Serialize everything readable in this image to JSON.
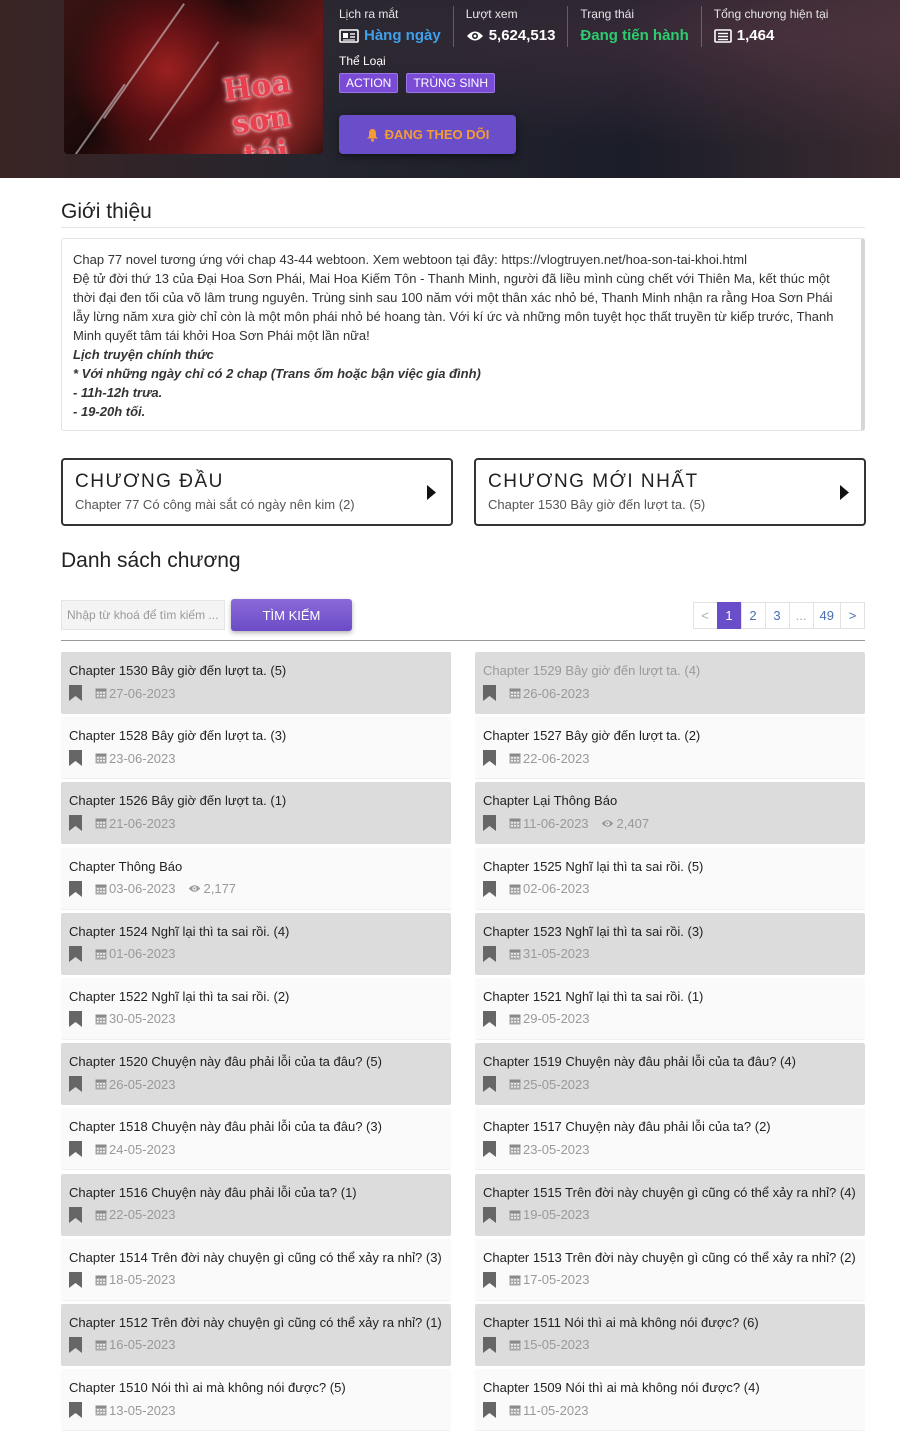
{
  "header": {
    "cover_title": "Hoa sơn tái khởi",
    "stats": [
      {
        "label": "Lịch ra mắt",
        "value": "Hàng ngày",
        "icon": "newspaper-icon",
        "color": "#3fa0ea"
      },
      {
        "label": "Lượt xem",
        "value": "5,624,513",
        "icon": "eye-icon",
        "color": "#ffffff"
      },
      {
        "label": "Trạng thái",
        "value": "Đang tiến hành",
        "icon": "",
        "color": "#2ecc71"
      },
      {
        "label": "Tổng chương hiện tại",
        "value": "1,464",
        "icon": "list-icon",
        "color": "#ffffff"
      }
    ],
    "genre_label": "Thể Loại",
    "genres": [
      "ACTION",
      "TRÙNG SINH"
    ],
    "follow_label": "ĐANG THEO DÕI"
  },
  "intro": {
    "title": "Giới thiệu",
    "lines": [
      "Chap 77 novel tương ứng với chap 43-44 webtoon. Xem webtoon tại đây: https://vlogtruyen.net/hoa-son-tai-khoi.html",
      "Đệ tử đời thứ 13 của Đại Hoa Sơn Phái, Mai Hoa Kiếm Tôn - Thanh Minh, người đã liều mình cùng chết với Thiên Ma, kết thúc một thời đại đen tối của võ lâm trung nguyên. Trùng sinh sau 100 năm với một thân xác nhỏ bé, Thanh Minh nhận ra rằng Hoa Sơn Phái lẫy lừng năm xưa giờ chỉ còn là một môn phái nhỏ bé hoang tàn. Với kí ức và những môn tuyệt học thất truyền từ kiếp trước, Thanh Minh quyết tâm tái khởi Hoa Sơn Phái một lần nữa!"
    ],
    "schedule_lines": [
      "Lịch truyện chính thức",
      "* Với những ngày chỉ có 2 chap (Trans ốm hoặc bận việc gia đình)",
      "- 11h-12h trưa.",
      "- 19-20h tối."
    ]
  },
  "jump": {
    "first": {
      "title": "CHƯƠNG ĐẦU",
      "chapter": "Chapter 77 Có công mài sắt có ngày nên kim (2)"
    },
    "latest": {
      "title": "CHƯƠNG MỚI NHẤT",
      "chapter": "Chapter 1530 Bây giờ đến lượt ta. (5)"
    }
  },
  "chapters_section": {
    "title": "Danh sách chương",
    "search_placeholder": "Nhập từ khoá để tìm kiếm ...",
    "search_button": "TÌM KIẾM",
    "pagination": [
      "<",
      "1",
      "2",
      "3",
      "...",
      "49",
      ">"
    ],
    "active_page": "1"
  },
  "chapters": [
    [
      {
        "name": "Chapter 1530 Bây giờ đến lượt ta. (5)",
        "date": "27-06-2023",
        "shaded": true
      },
      {
        "name": "Chapter 1529 Bây giờ đến lượt ta. (4)",
        "date": "26-06-2023",
        "shaded": true,
        "read": true
      }
    ],
    [
      {
        "name": "Chapter 1528 Bây giờ đến lượt ta. (3)",
        "date": "23-06-2023"
      },
      {
        "name": "Chapter 1527 Bây giờ đến lượt ta. (2)",
        "date": "22-06-2023"
      }
    ],
    [
      {
        "name": "Chapter 1526 Bây giờ đến lượt ta. (1)",
        "date": "21-06-2023",
        "shaded": true
      },
      {
        "name": "Chapter Lại Thông Báo",
        "date": "11-06-2023",
        "views": "2,407",
        "shaded": true
      }
    ],
    [
      {
        "name": "Chapter Thông Báo",
        "date": "03-06-2023",
        "views": "2,177"
      },
      {
        "name": "Chapter 1525 Nghĩ lại thì ta sai rồi. (5)",
        "date": "02-06-2023"
      }
    ],
    [
      {
        "name": "Chapter 1524 Nghĩ lại thì ta sai rồi. (4)",
        "date": "01-06-2023",
        "shaded": true
      },
      {
        "name": "Chapter 1523 Nghĩ lại thì ta sai rồi. (3)",
        "date": "31-05-2023",
        "shaded": true
      }
    ],
    [
      {
        "name": "Chapter 1522 Nghĩ lại thì ta sai rồi. (2)",
        "date": "30-05-2023"
      },
      {
        "name": "Chapter 1521 Nghĩ lại thì ta sai rồi. (1)",
        "date": "29-05-2023"
      }
    ],
    [
      {
        "name": "Chapter 1520 Chuyện này đâu phải lỗi của ta đâu? (5)",
        "date": "26-05-2023",
        "shaded": true
      },
      {
        "name": "Chapter 1519 Chuyện này đâu phải lỗi của ta đâu? (4)",
        "date": "25-05-2023",
        "shaded": true
      }
    ],
    [
      {
        "name": "Chapter 1518 Chuyện này đâu phải lỗi của ta đâu? (3)",
        "date": "24-05-2023"
      },
      {
        "name": "Chapter 1517 Chuyện này đâu phải lỗi của ta? (2)",
        "date": "23-05-2023"
      }
    ],
    [
      {
        "name": "Chapter 1516 Chuyện này đâu phải lỗi của ta? (1)",
        "date": "22-05-2023",
        "shaded": true
      },
      {
        "name": "Chapter 1515 Trên đời này chuyện gì cũng có thể xảy ra nhỉ? (4)",
        "date": "19-05-2023",
        "shaded": true
      }
    ],
    [
      {
        "name": "Chapter 1514 Trên đời này chuyện gì cũng có thể xảy ra nhỉ? (3)",
        "date": "18-05-2023"
      },
      {
        "name": "Chapter 1513 Trên đời này chuyện gì cũng có thể xảy ra nhỉ? (2)",
        "date": "17-05-2023"
      }
    ],
    [
      {
        "name": "Chapter 1512 Trên đời này chuyện gì cũng có thể xảy ra nhỉ? (1)",
        "date": "16-05-2023",
        "shaded": true
      },
      {
        "name": "Chapter 1511 Nói thì ai mà không nói được? (6)",
        "date": "15-05-2023",
        "shaded": true
      }
    ],
    [
      {
        "name": "Chapter 1510 Nói thì ai mà không nói được? (5)",
        "date": "13-05-2023"
      },
      {
        "name": "Chapter 1509 Nói thì ai mà không nói được? (4)",
        "date": "11-05-2023"
      }
    ]
  ]
}
